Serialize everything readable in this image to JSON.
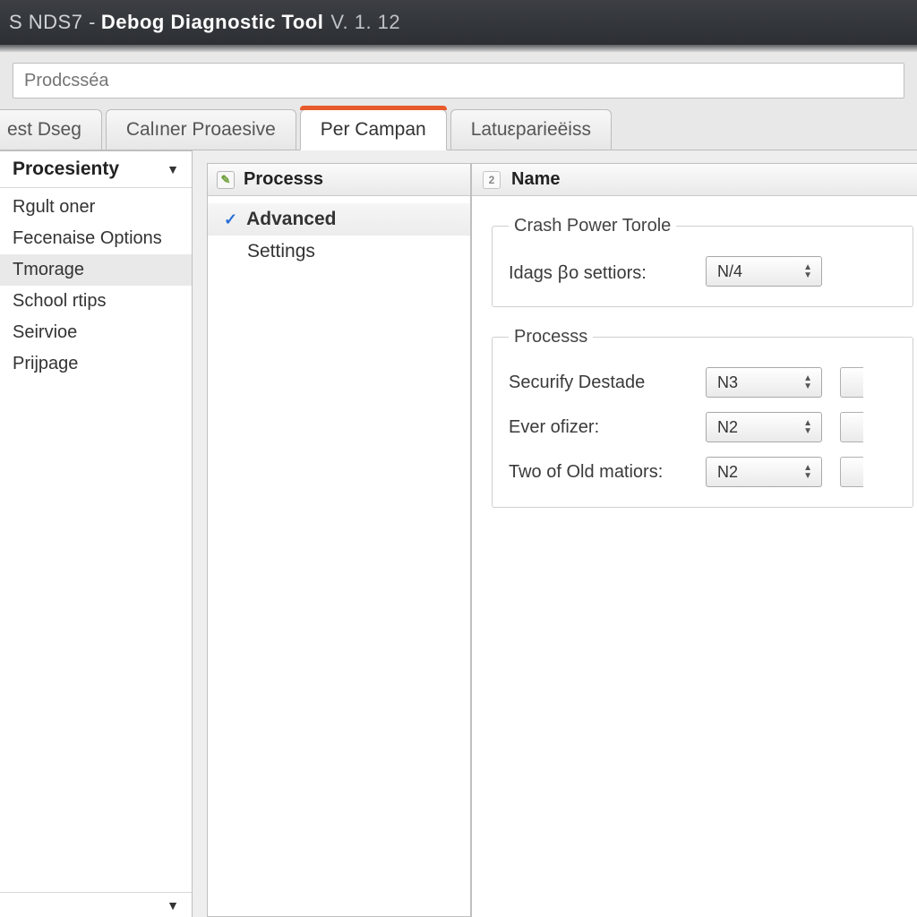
{
  "titlebar": {
    "prefix": "S NDS7 -",
    "title": "Debog Diagnostic Tool",
    "version": "V. 1. 12"
  },
  "path": {
    "placeholder": "Prodcsséa"
  },
  "tabs": [
    {
      "label": "est Dseg"
    },
    {
      "label": "Calıner Proaesive"
    },
    {
      "label": "Per Campan"
    },
    {
      "label": "Latuεparieëiss"
    }
  ],
  "active_tab_index": 2,
  "sidebar": {
    "header": "Procesienty",
    "items": [
      {
        "label": "Rgult oner"
      },
      {
        "label": "Fecenaise Options"
      },
      {
        "label": "Tmorage"
      },
      {
        "label": "School rtips"
      },
      {
        "label": "Seirvioe"
      },
      {
        "label": "Prijpage"
      }
    ],
    "selected_index": 2
  },
  "mid": {
    "header": "Processs",
    "items": [
      {
        "label": "Advanced"
      },
      {
        "label": "Settings"
      }
    ],
    "active_index": 0
  },
  "right": {
    "header_badge": "2",
    "header": "Name",
    "group1": {
      "legend": "Crash Power Torole",
      "row1_label": "Idags ꞵo settiors:",
      "row1_value": "N/4"
    },
    "group2": {
      "legend": "Processs",
      "rows": [
        {
          "label": "Securify Destade",
          "value": "N3"
        },
        {
          "label": "Ever ofizer:",
          "value": "N2"
        },
        {
          "label": "Two of Old matiors:",
          "value": "N2"
        }
      ]
    }
  }
}
